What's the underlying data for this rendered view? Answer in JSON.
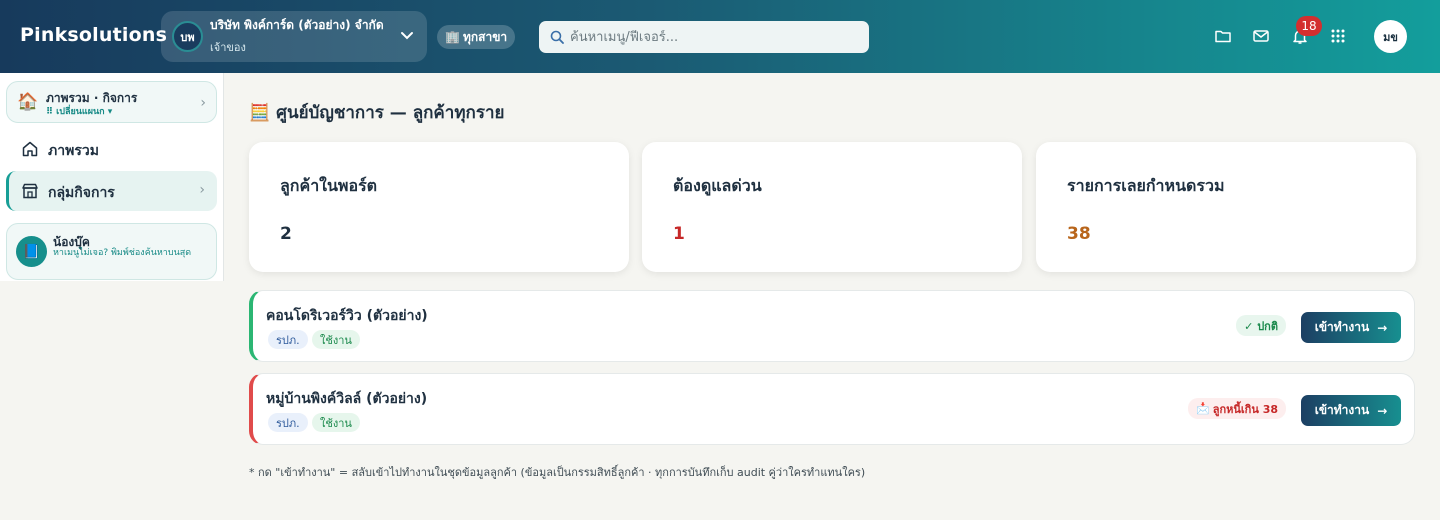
{
  "header": {
    "brand": "Pinksolutions",
    "company": {
      "initials": "บพ",
      "name": "บริษัท พิงค์การ์ด (ตัวอย่าง) จำกัด",
      "role": "เจ้าของ"
    },
    "branch_label": "ทุกสาขา",
    "search_placeholder": "ค้นหาเมนู/ฟีเจอร์...",
    "notifications_count": "18",
    "user_initials": "มข"
  },
  "sidebar": {
    "context_title": "ภาพรวม · กิจการ",
    "context_switch": "⠿ เปลี่ยนแผนก ▾",
    "items": [
      {
        "label": "ภาพรวม"
      },
      {
        "label": "กลุ่มกิจการ"
      }
    ],
    "helper": {
      "name": "น้องบุ๊ค",
      "desc": "หาเมนูไม่เจอ? พิมพ์ช่องค้นหาบนสุด"
    }
  },
  "main": {
    "title": "ศูนย์บัญชาการ — ลูกค้าทุกราย",
    "stats": [
      {
        "label": "ลูกค้าในพอร์ต",
        "value": "2",
        "color": "#1f3040"
      },
      {
        "label": "ต้องดูแลด่วน",
        "value": "1",
        "color": "#c62828"
      },
      {
        "label": "รายการเลยกำหนดรวม",
        "value": "38",
        "color": "#b8651b"
      }
    ],
    "clients": [
      {
        "name": "คอนโดริเวอร์วิว (ตัวอย่าง)",
        "type": "รปภ.",
        "status": "ใช้งาน",
        "badge": "✓ ปกติ",
        "button": "เข้าทำงาน"
      },
      {
        "name": "หมู่บ้านพิงค์วิลล์ (ตัวอย่าง)",
        "type": "รปภ.",
        "status": "ใช้งาน",
        "badge": "ลูกหนี้เกิน 38",
        "button": "เข้าทำงาน"
      }
    ],
    "footnote": "* กด \"เข้าทำงาน\" = สลับเข้าไปทำงานในชุดข้อมูลลูกค้า (ข้อมูลเป็นกรรมสิทธิ์ลูกค้า · ทุกการบันทึกเก็บ audit คู่ว่าใครทำแทนใคร)"
  }
}
